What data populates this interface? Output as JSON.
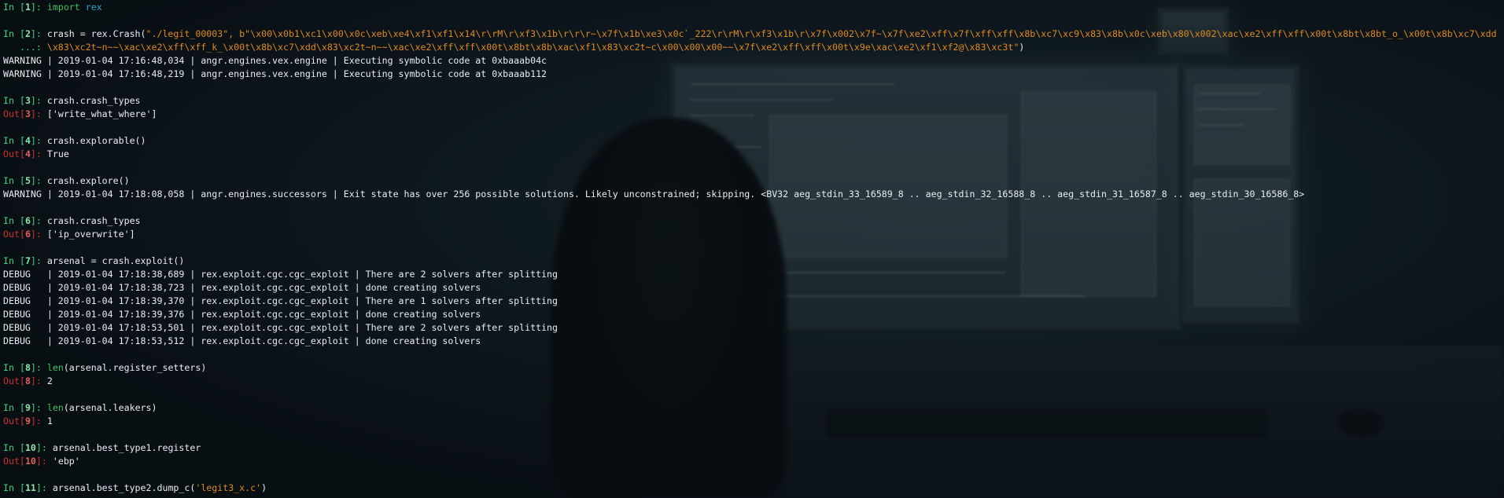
{
  "cells": [
    {
      "type": "in",
      "num": "1",
      "code": [
        {
          "t": "import",
          "c": "fn"
        },
        {
          "t": " ",
          "c": "plain"
        },
        {
          "t": "rex",
          "c": "kw"
        }
      ]
    },
    {
      "type": "blank"
    },
    {
      "type": "in",
      "num": "2",
      "code": [
        {
          "t": "crash = rex.Crash(",
          "c": "plain"
        },
        {
          "t": "\"./legit_00003\", b\"\\x00\\x0b1\\xc1\\x00\\x0c\\xeb\\xe4\\xf1\\xf1\\x14\\r\\rM\\r\\xf3\\x1b\\r\\r\\r~\\x7f\\x1b\\xe3\\x0c`_222\\r\\rM\\r\\xf3\\x1b\\r\\x7f\\x002\\x7f~\\x7f\\xe2\\xff\\x7f\\xff\\xff\\x8b\\xc7\\xc9\\x83\\x8b\\x0c\\xeb\\x80\\x002\\xac\\xe2\\xff\\xff\\x00t\\x8bt\\x8bt_o_\\x00t\\x8b\\xc7\\xdd",
          "c": "str"
        }
      ]
    },
    {
      "type": "cont",
      "code": [
        {
          "t": "\\x83\\xc2t~n~~\\xac\\xe2\\xff\\xff_k_\\x00t\\x8b\\xc7\\xdd\\x83\\xc2t~n~~\\xac\\xe2\\xff\\xff\\x00t\\x8bt\\x8b\\xac\\xf1\\x83\\xc2t~c\\x00\\x00\\x00~~\\x7f\\xe2\\xff\\xff\\x00t\\x9e\\xac\\xe2\\xf1\\xf2@\\x83\\xc3t\"",
          "c": "str"
        },
        {
          "t": ")",
          "c": "plain"
        }
      ]
    },
    {
      "type": "log",
      "text": "WARNING | 2019-01-04 17:16:48,034 | angr.engines.vex.engine | Executing symbolic code at 0xbaaab04c"
    },
    {
      "type": "log",
      "text": "WARNING | 2019-01-04 17:16:48,219 | angr.engines.vex.engine | Executing symbolic code at 0xbaaab112"
    },
    {
      "type": "blank"
    },
    {
      "type": "in",
      "num": "3",
      "code": [
        {
          "t": "crash.crash_types",
          "c": "plain"
        }
      ]
    },
    {
      "type": "out",
      "num": "3",
      "code": [
        {
          "t": "['write_what_where']",
          "c": "plain"
        }
      ]
    },
    {
      "type": "blank"
    },
    {
      "type": "in",
      "num": "4",
      "code": [
        {
          "t": "crash.explorable()",
          "c": "plain"
        }
      ]
    },
    {
      "type": "out",
      "num": "4",
      "code": [
        {
          "t": "True",
          "c": "plain"
        }
      ]
    },
    {
      "type": "blank"
    },
    {
      "type": "in",
      "num": "5",
      "code": [
        {
          "t": "crash.explore()",
          "c": "plain"
        }
      ]
    },
    {
      "type": "log",
      "text": "WARNING | 2019-01-04 17:18:08,058 | angr.engines.successors | Exit state has over 256 possible solutions. Likely unconstrained; skipping. <BV32 aeg_stdin_33_16589_8 .. aeg_stdin_32_16588_8 .. aeg_stdin_31_16587_8 .. aeg_stdin_30_16586_8>"
    },
    {
      "type": "blank"
    },
    {
      "type": "in",
      "num": "6",
      "code": [
        {
          "t": "crash.crash_types",
          "c": "plain"
        }
      ]
    },
    {
      "type": "out",
      "num": "6",
      "code": [
        {
          "t": "['ip_overwrite']",
          "c": "plain"
        }
      ]
    },
    {
      "type": "blank"
    },
    {
      "type": "in",
      "num": "7",
      "code": [
        {
          "t": "arsenal = crash.exploit()",
          "c": "plain"
        }
      ]
    },
    {
      "type": "log",
      "text": "DEBUG   | 2019-01-04 17:18:38,689 | rex.exploit.cgc.cgc_exploit | There are 2 solvers after splitting"
    },
    {
      "type": "log",
      "text": "DEBUG   | 2019-01-04 17:18:38,723 | rex.exploit.cgc.cgc_exploit | done creating solvers"
    },
    {
      "type": "log",
      "text": "DEBUG   | 2019-01-04 17:18:39,370 | rex.exploit.cgc.cgc_exploit | There are 1 solvers after splitting"
    },
    {
      "type": "log",
      "text": "DEBUG   | 2019-01-04 17:18:39,376 | rex.exploit.cgc.cgc_exploit | done creating solvers"
    },
    {
      "type": "log",
      "text": "DEBUG   | 2019-01-04 17:18:53,501 | rex.exploit.cgc.cgc_exploit | There are 2 solvers after splitting"
    },
    {
      "type": "log",
      "text": "DEBUG   | 2019-01-04 17:18:53,512 | rex.exploit.cgc.cgc_exploit | done creating solvers"
    },
    {
      "type": "blank"
    },
    {
      "type": "in",
      "num": "8",
      "code": [
        {
          "t": "len",
          "c": "fn"
        },
        {
          "t": "(arsenal.register_setters)",
          "c": "plain"
        }
      ]
    },
    {
      "type": "out",
      "num": "8",
      "code": [
        {
          "t": "2",
          "c": "plain"
        }
      ]
    },
    {
      "type": "blank"
    },
    {
      "type": "in",
      "num": "9",
      "code": [
        {
          "t": "len",
          "c": "fn"
        },
        {
          "t": "(arsenal.leakers)",
          "c": "plain"
        }
      ]
    },
    {
      "type": "out",
      "num": "9",
      "code": [
        {
          "t": "1",
          "c": "plain"
        }
      ]
    },
    {
      "type": "blank"
    },
    {
      "type": "in",
      "num": "10",
      "code": [
        {
          "t": "arsenal.best_type1.register",
          "c": "plain"
        }
      ]
    },
    {
      "type": "out",
      "num": "10",
      "code": [
        {
          "t": "'ebp'",
          "c": "plain"
        }
      ]
    },
    {
      "type": "blank"
    },
    {
      "type": "in",
      "num": "11",
      "code": [
        {
          "t": "arsenal.best_type2.dump_c(",
          "c": "plain"
        },
        {
          "t": "'legit3_x.c'",
          "c": "str"
        },
        {
          "t": ")",
          "c": "plain"
        }
      ]
    }
  ],
  "prompt": {
    "in_word": "In ",
    "out_word": "Out",
    "open": "[",
    "close": "]: ",
    "cont": "   ...: "
  },
  "colors": {
    "in": "#3fd07a",
    "out": "#d0302b",
    "string": "#e08a1e",
    "keyword": "#2aa7c8"
  }
}
